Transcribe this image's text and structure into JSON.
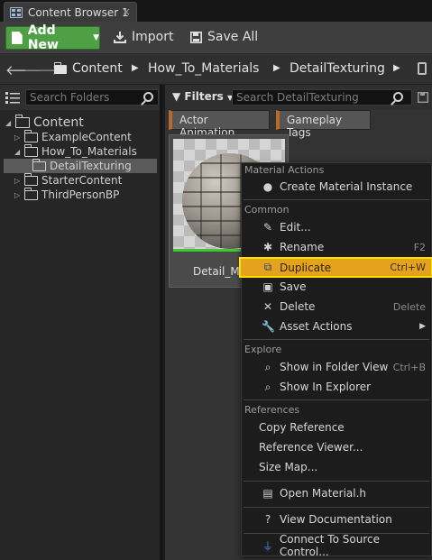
{
  "tab": {
    "title": "Content Browser 1",
    "close_glyph": "×"
  },
  "toolbar": {
    "add_new_label": "Add New",
    "import_label": "Import",
    "save_all_label": "Save All"
  },
  "path": {
    "crumbs": [
      "Content",
      "How_To_Materials",
      "DetailTexturing"
    ]
  },
  "sidebar": {
    "search_placeholder": "Search Folders",
    "tree": [
      {
        "label": "Content"
      },
      {
        "label": "ExampleContent"
      },
      {
        "label": "How_To_Materials"
      },
      {
        "label": "DetailTexturing"
      },
      {
        "label": "StarterContent"
      },
      {
        "label": "ThirdPersonBP"
      }
    ]
  },
  "content": {
    "filters_label": "Filters",
    "search_placeholder": "Search DetailTexturing",
    "filter_chips": [
      "Actor Animation",
      "Gameplay Tags"
    ],
    "asset_name": "Detail_Ma"
  },
  "context_menu": {
    "sections": {
      "material_actions": "Material Actions",
      "common": "Common",
      "explore": "Explore",
      "references": "References"
    },
    "items": {
      "create_material_instance": "Create Material Instance",
      "edit": "Edit...",
      "rename": "Rename",
      "rename_shortcut": "F2",
      "duplicate": "Duplicate",
      "duplicate_shortcut": "Ctrl+W",
      "save": "Save",
      "delete": "Delete",
      "delete_shortcut": "Delete",
      "asset_actions": "Asset Actions",
      "show_in_folder_view": "Show in Folder View",
      "show_in_folder_view_shortcut": "Ctrl+B",
      "show_in_explorer": "Show In Explorer",
      "copy_reference": "Copy Reference",
      "reference_viewer": "Reference Viewer...",
      "size_map": "Size Map...",
      "open_material_h": "Open Material.h",
      "view_documentation": "View Documentation",
      "connect_to_source_control": "Connect To Source Control..."
    }
  },
  "colors": {
    "add_new_green": "#4fa044",
    "highlight": "#e5a21c",
    "highlight_border": "#ffe000",
    "asset_underline": "#3fcb2f"
  }
}
